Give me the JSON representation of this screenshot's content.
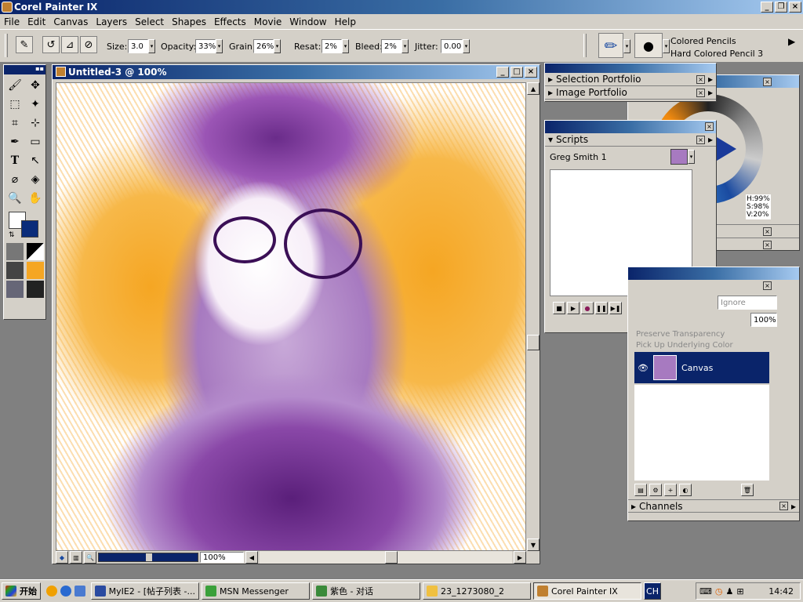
{
  "app": {
    "title": "Corel Painter IX"
  },
  "menu": [
    "File",
    "Edit",
    "Canvas",
    "Layers",
    "Select",
    "Shapes",
    "Effects",
    "Movie",
    "Window",
    "Help"
  ],
  "toolbar": {
    "size_label": "Size:",
    "size": "3.0",
    "opacity_label": "Opacity:",
    "opacity": "33%",
    "grain_label": "Grain:",
    "grain": "26%",
    "resat_label": "Resat:",
    "resat": "2%",
    "bleed_label": "Bleed:",
    "bleed": "2%",
    "jitter_label": "Jitter:",
    "jitter": "0.00",
    "brush_category": "Colored Pencils",
    "brush_variant": "Hard Colored Pencil 3"
  },
  "document": {
    "title": "Untitled-3 @ 100%",
    "zoom": "100%"
  },
  "portfolio": {
    "items": [
      "Selection Portfolio",
      "Image Portfolio"
    ]
  },
  "scripts": {
    "title": "Scripts",
    "selected": "Greg Smith 1"
  },
  "color": {
    "h": "H:99%",
    "s": "S:98%",
    "v": "V:20%"
  },
  "layers": {
    "composite": "Ignore",
    "opacity": "100%",
    "preserve": "Preserve Transparency",
    "pickup": "Pick Up Underlying Color",
    "layer_name": "Canvas",
    "channels": "Channels"
  },
  "taskbar": {
    "start": "开始",
    "tasks": [
      "MyIE2 - [帖子列表 -...",
      "MSN Messenger",
      "紫色 - 对话",
      "23_1273080_2",
      "Corel Painter IX"
    ],
    "ime": "CH",
    "clock": "14:42"
  }
}
